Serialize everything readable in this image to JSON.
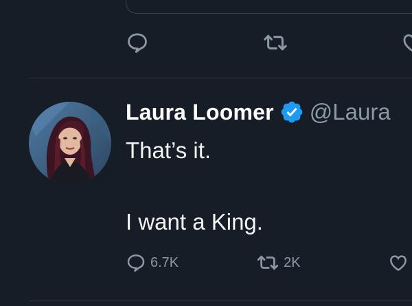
{
  "previous_tweet": {
    "actions": {
      "reply_icon": "reply-icon",
      "retweet_icon": "retweet-icon",
      "like_icon": "like-icon"
    }
  },
  "tweet": {
    "author": {
      "display_name": "Laura Loomer",
      "handle": "@Laura",
      "verified": true,
      "avatar": "profile-photo"
    },
    "text_lines": [
      "That’s it.",
      "",
      "I want a King."
    ],
    "actions": {
      "replies": "6.7K",
      "retweets": "2K",
      "reply_icon": "reply-icon",
      "retweet_icon": "retweet-icon",
      "like_icon": "like-icon"
    }
  },
  "colors": {
    "background": "#161d27",
    "muted": "#8b98a5",
    "divider": "#2f3336",
    "verified_badge": "#1d9bf0"
  }
}
